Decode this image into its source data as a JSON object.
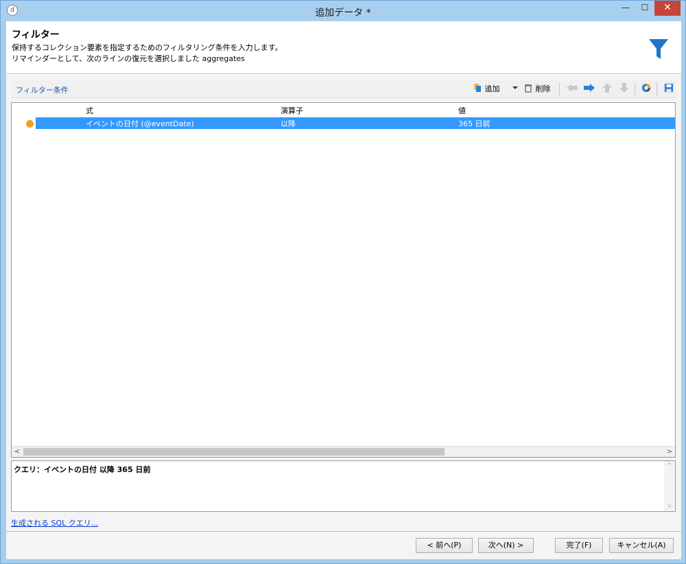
{
  "window": {
    "title": "追加データ *",
    "app_icon_glyph": "d",
    "min_glyph": "—",
    "max_glyph": "☐",
    "close_glyph": "✕"
  },
  "header": {
    "title": "フィルター",
    "desc1": "保持するコレクション要素を指定するためのフィルタリング条件を入力します。",
    "desc2": "リマインダーとして、次のラインの復元を選択しました aggregates",
    "icon": "funnel-icon",
    "icon_color": "#1e74c8"
  },
  "toolbar": {
    "label": "フィルター条件",
    "add_label": "追加",
    "delete_label": "削除",
    "icons": [
      "add-icon",
      "dropdown-arrow-icon",
      "trash-icon",
      "arrow-left-icon",
      "arrow-right-icon",
      "arrow-up-icon",
      "arrow-down-icon",
      "chart-icon",
      "save-icon"
    ]
  },
  "grid": {
    "columns": [
      "式",
      "演算子",
      "値"
    ],
    "rows": [
      {
        "expression": "イベントの日付 (@eventDate)",
        "operator": "以降",
        "value": "365 日前",
        "status_color": "#f0a020"
      }
    ],
    "selection_color": "#3399ff"
  },
  "query": {
    "text": "クエリ：イベントの日付 以降 365 日前"
  },
  "sql_link": "生成される SQL クエリ...",
  "buttons": {
    "prev": "< 前へ(P)",
    "next": "次へ(N) >",
    "finish": "完了(F)",
    "cancel": "キャンセル(A)"
  }
}
